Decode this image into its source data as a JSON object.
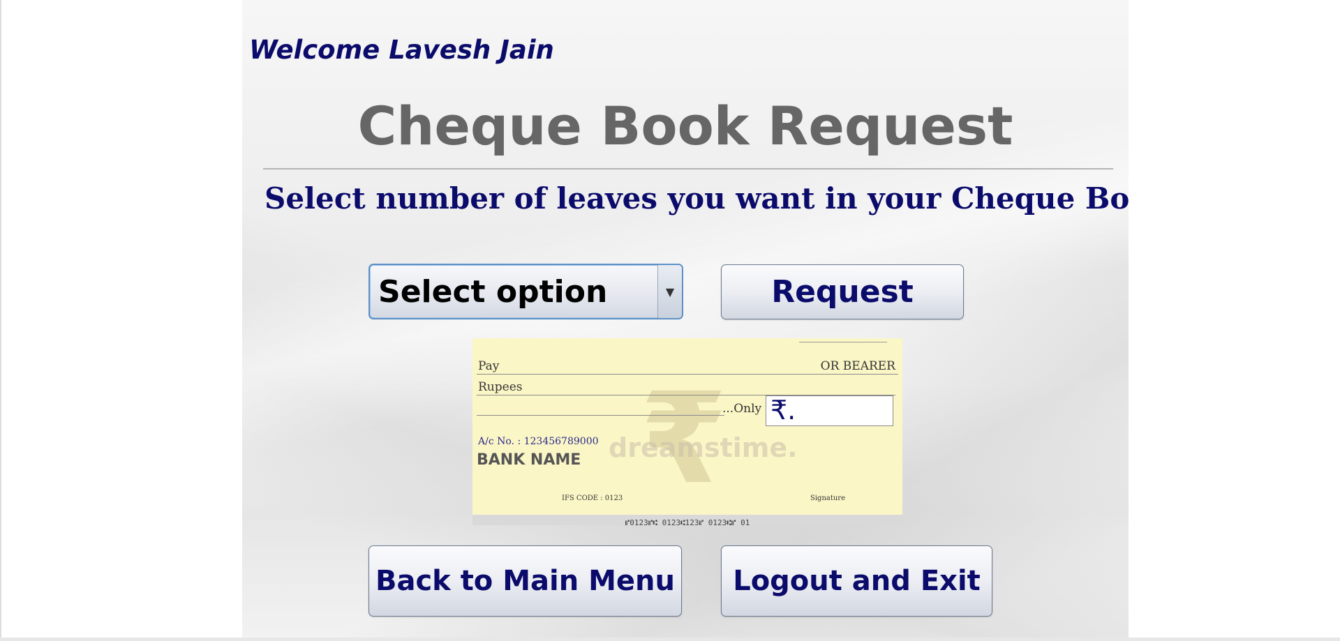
{
  "header": {
    "welcome": "Welcome Lavesh Jain",
    "title": "Cheque Book Request",
    "subtitle": "Select number of leaves you want in your Cheque Book"
  },
  "form": {
    "select_value": "Select option",
    "request_label": "Request"
  },
  "cheque": {
    "pay": "Pay",
    "bearer": "OR BEARER",
    "rupees": "Rupees",
    "only": "...Only",
    "rupee_symbol": "₹.",
    "watermark_symbol": "₹",
    "watermark_text": "dreamstime.",
    "account_no": "A/c No. : 123456789000",
    "bank_name": "BANK NAME",
    "ifs_code": "IFS CODE : 0123",
    "signature": "Signature",
    "micr": "⑈0123⑈⑆ 0123⑆123⑈ 0123⑆⑈ 01"
  },
  "footer": {
    "back_label": "Back to Main Menu",
    "logout_label": "Logout and Exit"
  },
  "colors": {
    "heading_navy": "#0b0b6b",
    "title_gray": "#666666",
    "cheque_yellow": "#fbf6c6"
  }
}
